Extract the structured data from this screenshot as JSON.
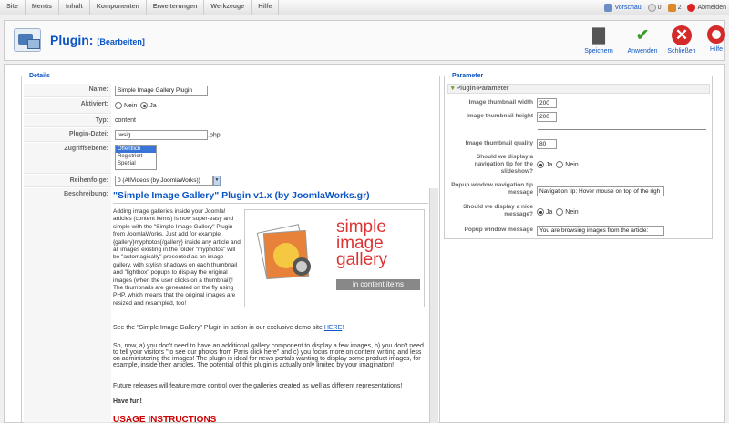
{
  "menu": [
    "Site",
    "Menüs",
    "Inhalt",
    "Komponenten",
    "Erweiterungen",
    "Werkzeuge",
    "Hilfe"
  ],
  "status": {
    "preview": "Vorschau",
    "messages": "0",
    "users": "2",
    "logout": "Abmelden"
  },
  "toolbar": {
    "title": "Plugin:",
    "subtitle": "[Bearbeiten]",
    "save": "Speichern",
    "apply": "Anwenden",
    "close": "Schließen",
    "help": "Hilfe"
  },
  "details": {
    "legend": "Details",
    "name_label": "Name:",
    "name_value": "Simple Image Gallery Plugin",
    "enabled_label": "Aktiviert:",
    "no": "Nein",
    "yes": "Ja",
    "type_label": "Typ:",
    "type_value": "content",
    "file_label": "Plugin-Datei:",
    "file_value": "jwsig",
    "file_ext": ".php",
    "access_label": "Zugriffsebene:",
    "access_options": [
      "Öffentlich",
      "Registriert",
      "Spezial"
    ],
    "order_label": "Reihenfolge:",
    "order_value": "0 (AllVideos (by JoomlaWorks))",
    "desc_label": "Beschreibung:",
    "desc_title": "\"Simple Image Gallery\" Plugin v1.x (by JoomlaWorks.gr)",
    "p1": "Adding image galleries inside your Joomla! articles (content items) is now super-easy and simple with the \"Simple Image Gallery\" Plugin from JoomlaWorks. Just add for example {gallery}myphotos{/gallery} inside any article and all images existing in the folder \"myphotos\" will be \"automagically\" presented as an image gallery, with stylish shadows on each thumbnail and \"lightbox\" popups to display the original images (when the user clicks on a thumbnail)! The thumbnails are generated on the fly using PHP, which means that the original images are resized and resampled, too!",
    "p2a": "See the \"Simple Image Gallery\" Plugin in action in our exclusive demo site ",
    "p2link": "HERE",
    "p2b": "!",
    "p3": "So, now, a) you don't need to have an additional gallery component to display a few images, b) you don't need to tell your visitors \"to see our photos from Paris click here\" and c) you focus more on content writing and less on administering the images! The plugin is ideal for news portals wanting to display some product images, for example, inside their articles. The potential of this plugin is actually only limited by your imagination!",
    "p4": "Future releases will feature more control over the galleries created as well as different representations!",
    "p5": "Have fun!",
    "usage": "USAGE INSTRUCTIONS",
    "logo_line1": "simple",
    "logo_line2": "image",
    "logo_line3": "gallery",
    "logo_line4": "in content items"
  },
  "params": {
    "legend": "Parameter",
    "section": "Plugin-Parameter",
    "width_label": "Image thumbnail width",
    "width_value": "200",
    "height_label": "Image thumbnail height",
    "height_value": "200",
    "quality_label": "Image thumbnail quality",
    "quality_value": "80",
    "navtip_label": "Should we display a navigation tip for the slideshow?",
    "navmsg_label": "Popup window navigation tip message",
    "navmsg_value": "Navigation tip: Hover mouse on top of the righ",
    "nice_label": "Should we display a nice message?",
    "popup_label": "Popup window message",
    "popup_value": "You are browsing images from the article:",
    "yes": "Ja",
    "no": "Nein"
  }
}
